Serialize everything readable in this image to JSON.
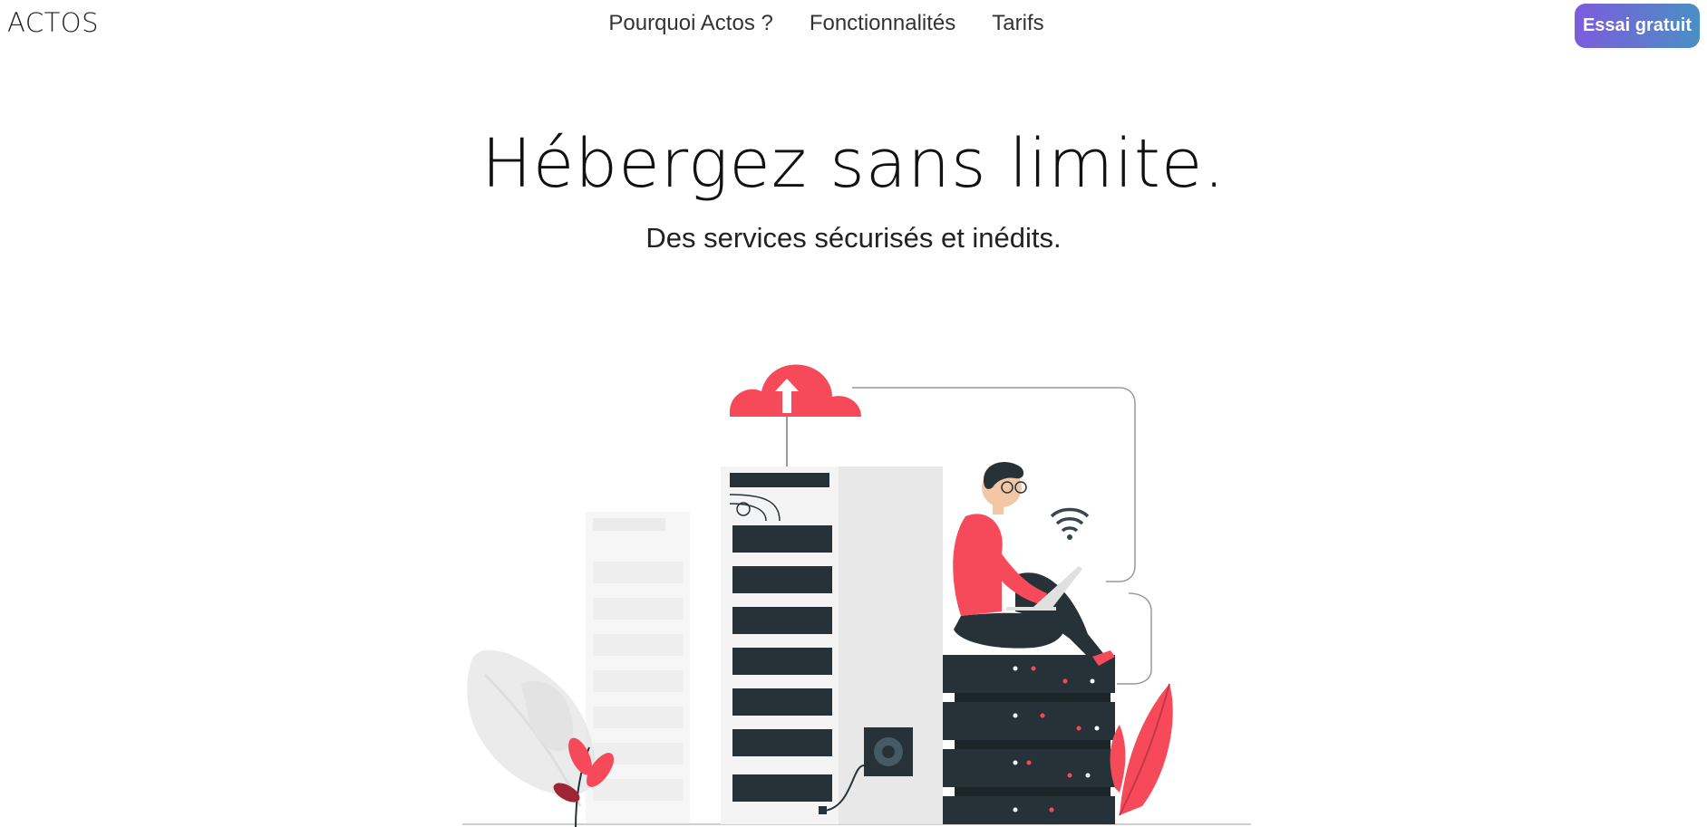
{
  "navbar": {
    "brand": "ACTOS",
    "links": [
      {
        "label": "Pourquoi Actos ?"
      },
      {
        "label": "Fonctionnalités"
      },
      {
        "label": "Tarifs"
      }
    ],
    "cta_label": "Essai gratuit"
  },
  "hero": {
    "title": "Hébergez sans limite.",
    "subtitle": "Des services sécurisés et inédits."
  },
  "colors": {
    "accent_red": "#f64a5a",
    "server_dark": "#263238",
    "cta_gradient_start": "#7c5cdc",
    "cta_gradient_end": "#4a8fc4"
  },
  "illustration": {
    "icons": [
      "cloud-upload-icon",
      "wifi-icon",
      "server-rack",
      "person-with-laptop",
      "leaf-decoration"
    ]
  }
}
